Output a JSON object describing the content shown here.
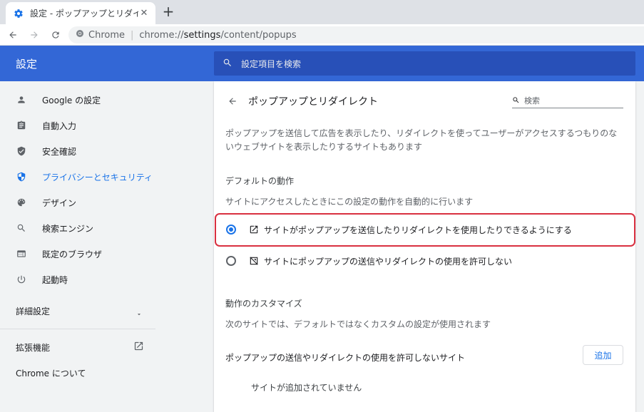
{
  "browser": {
    "tab_title": "設定 - ポップアップとリダイレクト",
    "tab_close": "✕",
    "new_tab": "+",
    "omnibox": {
      "site": "Chrome",
      "url_prefix": "chrome://",
      "url_host": "settings",
      "url_path": "/content/popups"
    }
  },
  "header": {
    "title": "設定",
    "search_placeholder": "設定項目を検索"
  },
  "sidebar": {
    "items": [
      {
        "label": "Google の設定",
        "icon": "person-icon"
      },
      {
        "label": "自動入力",
        "icon": "clipboard-icon"
      },
      {
        "label": "安全確認",
        "icon": "shield-check-icon"
      },
      {
        "label": "プライバシーとセキュリティ",
        "icon": "shield-icon",
        "active": true
      },
      {
        "label": "デザイン",
        "icon": "palette-icon"
      },
      {
        "label": "検索エンジン",
        "icon": "search-icon"
      },
      {
        "label": "既定のブラウザ",
        "icon": "browser-icon"
      },
      {
        "label": "起動時",
        "icon": "power-icon"
      }
    ],
    "advanced": "詳細設定",
    "extensions": "拡張機能",
    "about": "Chrome について"
  },
  "content": {
    "title": "ポップアップとリダイレクト",
    "search_placeholder": "検索",
    "description": "ポップアップを送信して広告を表示したり、リダイレクトを使ってユーザーがアクセスするつもりのないウェブサイトを表示したりするサイトもあります",
    "default_heading": "デフォルトの動作",
    "default_sub": "サイトにアクセスしたときにこの設定の動作を自動的に行います",
    "option_allow": "サイトがポップアップを送信したりリダイレクトを使用したりできるようにする",
    "option_block": "サイトにポップアップの送信やリダイレクトの使用を許可しない",
    "option_selected": "allow",
    "customize_heading": "動作のカスタマイズ",
    "customize_sub": "次のサイトでは、デフォルトではなくカスタムの設定が使用されます",
    "blocked_heading": "ポップアップの送信やリダイレクトの使用を許可しないサイト",
    "add_button": "追加",
    "empty_note": "サイトが追加されていません"
  },
  "colors": {
    "header_bg": "#3367d6",
    "accent": "#1a73e8",
    "highlight": "#d93040"
  }
}
